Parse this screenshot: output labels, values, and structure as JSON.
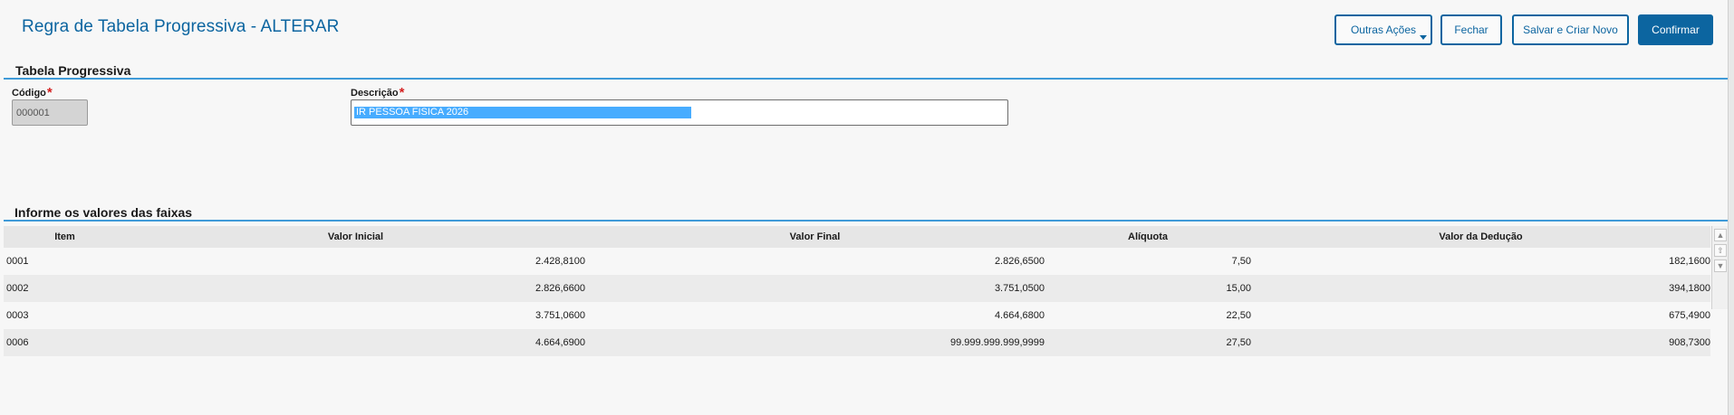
{
  "header": {
    "title": "Regra de Tabela Progressiva - ALTERAR",
    "buttons": {
      "other_actions": "Outras Ações",
      "close": "Fechar",
      "save_new": "Salvar e Criar Novo",
      "confirm": "Confirmar"
    }
  },
  "form": {
    "section_title": "Tabela Progressiva",
    "code_label": "Código",
    "code_value": "000001",
    "desc_label": "Descrição",
    "desc_value": "IR PESSOA FISICA 2026",
    "required_mark": "*"
  },
  "grid": {
    "section_title": "Informe os valores das faixas",
    "columns": [
      "Item",
      "Valor Inicial",
      "Valor Final",
      "Alíquota",
      "Valor da Dedução"
    ],
    "rows": [
      [
        "0001",
        "2.428,8100",
        "2.826,6500",
        "7,50",
        "182,1600"
      ],
      [
        "0002",
        "2.826,6600",
        "3.751,0500",
        "15,00",
        "394,1800"
      ],
      [
        "0003",
        "3.751,0600",
        "4.664,6800",
        "22,50",
        "675,4900"
      ],
      [
        "0006",
        "4.664,6900",
        "99.999.999.999,9999",
        "27,50",
        "908,7300"
      ]
    ]
  },
  "icons": {
    "dropdown": "caret-down-icon",
    "scroll_up": "arrow-up-icon",
    "scroll_top": "scroll-top-icon",
    "scroll_down": "arrow-down-icon"
  },
  "colors": {
    "accent": "#0c65a0",
    "section_line": "#3f9ad8",
    "required": "#d41f1f",
    "selection": "#47acff"
  }
}
